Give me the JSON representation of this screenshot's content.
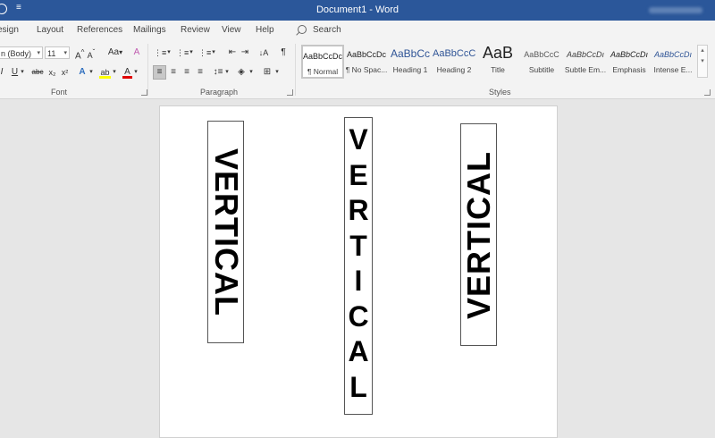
{
  "titlebar": {
    "title": "Document1 - Word",
    "quick_access_menu": "≡"
  },
  "tabs": [
    "esign",
    "Layout",
    "References",
    "Mailings",
    "Review",
    "View",
    "Help"
  ],
  "search": {
    "label": "Search"
  },
  "font_group": {
    "label": "Font",
    "font_name": "n (Body)",
    "font_size": "11",
    "grow": "A",
    "shrink": "A",
    "change_case": "Aa",
    "clear_format": "A",
    "italic": "I",
    "underline": "U",
    "strikethrough": "abc",
    "subscript": "x₂",
    "superscript": "x²",
    "text_effects": "A",
    "highlight": "ab",
    "font_color": "A"
  },
  "paragraph_group": {
    "label": "Paragraph",
    "pilcrow": "¶"
  },
  "styles_group": {
    "label": "Styles",
    "items": [
      {
        "preview": "AaBbCcDc",
        "name": "¶ Normal"
      },
      {
        "preview": "AaBbCcDc",
        "name": "¶ No Spac..."
      },
      {
        "preview": "AaBbCc",
        "name": "Heading 1"
      },
      {
        "preview": "AaBbCcC",
        "name": "Heading 2"
      },
      {
        "preview": "AaB",
        "name": "Title"
      },
      {
        "preview": "AaBbCcC",
        "name": "Subtitle"
      },
      {
        "preview": "AaBbCcDı",
        "name": "Subtle Em..."
      },
      {
        "preview": "AaBbCcDı",
        "name": "Emphasis"
      },
      {
        "preview": "AaBbCcDı",
        "name": "Intense E..."
      }
    ]
  },
  "document": {
    "textbox_1": "VERTICAL",
    "textbox_2": "V\nE\nR\nT\nI\nC\nA\nL",
    "textbox_3": "VERTICAL"
  },
  "colors": {
    "title_bar": "#2b579a",
    "highlight_yellow": "#ffff00",
    "font_red": "#e00000",
    "heading_blue": "#2f5496"
  }
}
